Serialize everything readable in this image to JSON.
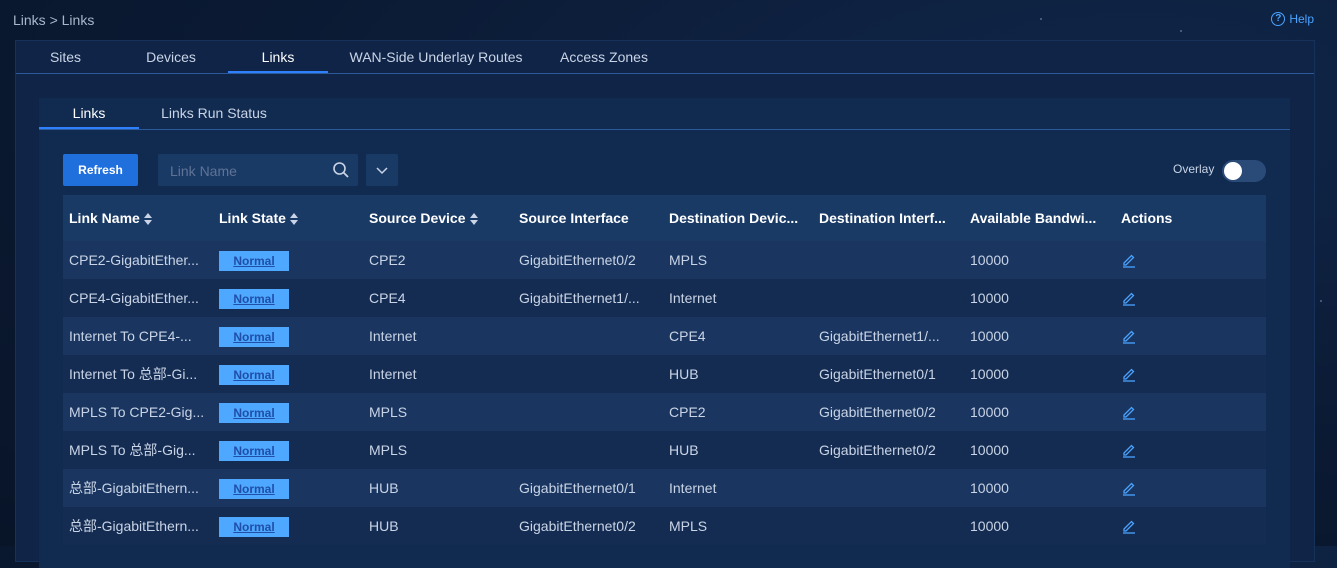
{
  "breadcrumb": "Links > Links",
  "help": {
    "label": "Help",
    "icon": "question-circle-icon"
  },
  "main_tabs": [
    {
      "label": "Sites"
    },
    {
      "label": "Devices"
    },
    {
      "label": "Links",
      "active": true
    },
    {
      "label": "WAN-Side Underlay Routes"
    },
    {
      "label": "Access Zones"
    }
  ],
  "sub_tabs": [
    {
      "label": "Links",
      "active": true
    },
    {
      "label": "Links Run Status"
    }
  ],
  "toolbar": {
    "refresh_label": "Refresh",
    "search_placeholder": "Link Name",
    "search_value": "",
    "overlay_label": "Overlay",
    "overlay_on": false
  },
  "colors": {
    "accent": "#1f6fdd",
    "badge_bg": "#4ea8ff",
    "badge_text": "#1f4fa8",
    "link_icon": "#4aa3ff"
  },
  "table": {
    "headers": [
      "Link Name",
      "Link State",
      "Source Device",
      "Source Interface",
      "Destination Devic...",
      "Destination Interf...",
      "Available Bandwi...",
      "Actions"
    ],
    "rows": [
      {
        "name": "CPE2-GigabitEther...",
        "state": "Normal",
        "src_dev": "CPE2",
        "src_if": "GigabitEthernet0/2",
        "dst_dev": "MPLS",
        "dst_if": "",
        "bw": "10000"
      },
      {
        "name": "CPE4-GigabitEther...",
        "state": "Normal",
        "src_dev": "CPE4",
        "src_if": "GigabitEthernet1/...",
        "dst_dev": "Internet",
        "dst_if": "",
        "bw": "10000"
      },
      {
        "name": "Internet To CPE4-...",
        "state": "Normal",
        "src_dev": "Internet",
        "src_if": "",
        "dst_dev": "CPE4",
        "dst_if": "GigabitEthernet1/...",
        "bw": "10000"
      },
      {
        "name": "Internet To 总部-Gi...",
        "state": "Normal",
        "src_dev": "Internet",
        "src_if": "",
        "dst_dev": "HUB",
        "dst_if": "GigabitEthernet0/1",
        "bw": "10000"
      },
      {
        "name": "MPLS To CPE2-Gig...",
        "state": "Normal",
        "src_dev": "MPLS",
        "src_if": "",
        "dst_dev": "CPE2",
        "dst_if": "GigabitEthernet0/2",
        "bw": "10000"
      },
      {
        "name": "MPLS To 总部-Gig...",
        "state": "Normal",
        "src_dev": "MPLS",
        "src_if": "",
        "dst_dev": "HUB",
        "dst_if": "GigabitEthernet0/2",
        "bw": "10000"
      },
      {
        "name": "总部-GigabitEthern...",
        "state": "Normal",
        "src_dev": "HUB",
        "src_if": "GigabitEthernet0/1",
        "dst_dev": "Internet",
        "dst_if": "",
        "bw": "10000"
      },
      {
        "name": "总部-GigabitEthern...",
        "state": "Normal",
        "src_dev": "HUB",
        "src_if": "GigabitEthernet0/2",
        "dst_dev": "MPLS",
        "dst_if": "",
        "bw": "10000"
      }
    ]
  }
}
